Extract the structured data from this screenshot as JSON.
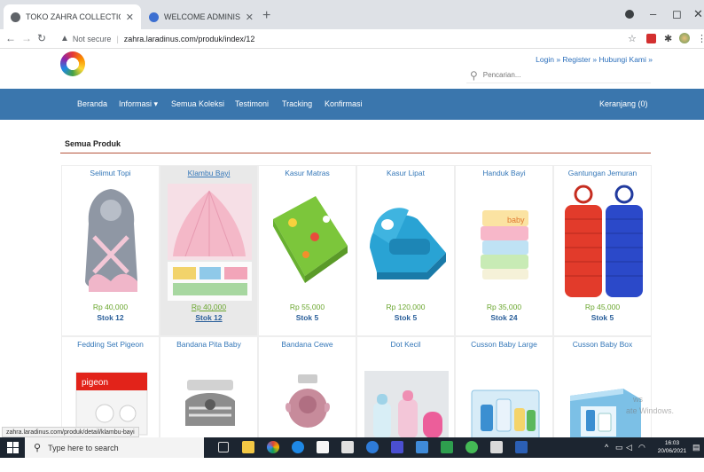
{
  "browser": {
    "tabs": [
      {
        "title": "TOKO ZAHRA COLLECTION",
        "active": true
      },
      {
        "title": "WELCOME ADMINISTRATOR",
        "active": false
      }
    ],
    "new_tab_symbol": "+",
    "window_controls": {
      "minimize": "–",
      "maximize": "◻",
      "close": "✕"
    },
    "security_label": "Not secure",
    "url": "zahra.laradinus.com/produk/index/12"
  },
  "header": {
    "top_links": "Login » Register » Hubungi Kami »",
    "search_placeholder": "Pencarian...",
    "search_icon": "magnifier-icon"
  },
  "nav": {
    "items": [
      "Beranda",
      "Informasi ▾",
      "Semua Koleksi",
      "Testimoni",
      "Tracking",
      "Konfirmasi"
    ],
    "cart": "Keranjang (0)"
  },
  "section": {
    "title": "Semua Produk"
  },
  "products": [
    {
      "name": "Selimut Topi",
      "price": "Rp 40,000",
      "stock": "Stok 12"
    },
    {
      "name": "Klambu Bayi",
      "price": "Rp 40,000",
      "stock": "Stok 12"
    },
    {
      "name": "Kasur Matras",
      "price": "Rp 55,000",
      "stock": "Stok 5"
    },
    {
      "name": "Kasur Lipat",
      "price": "Rp 120,000",
      "stock": "Stok 5"
    },
    {
      "name": "Handuk Bayi",
      "price": "Rp 35,000",
      "stock": "Stok 24"
    },
    {
      "name": "Gantungan Jemuran",
      "price": "Rp 45,000",
      "stock": "Stok 5"
    },
    {
      "name": "Fedding Set Pigeon"
    },
    {
      "name": "Bandana Pita Baby"
    },
    {
      "name": "Bandana Cewe"
    },
    {
      "name": "Dot Kecil"
    },
    {
      "name": "Cusson Baby Large"
    },
    {
      "name": "Cusson Baby Box"
    }
  ],
  "status_url": "zahra.laradinus.com/produk/detail/klambu-bayi",
  "watermark": {
    "line1": "ws",
    "line2": "ate Windows."
  },
  "taskbar": {
    "search_placeholder": "Type here to search",
    "time": "16:03",
    "date": "20/06/2021"
  },
  "colors": {
    "nav_bg": "#3a76ad",
    "link": "#3477b8",
    "price": "#6aa62e",
    "stock": "#2a5f9a",
    "section_rule": "#b6553d"
  }
}
